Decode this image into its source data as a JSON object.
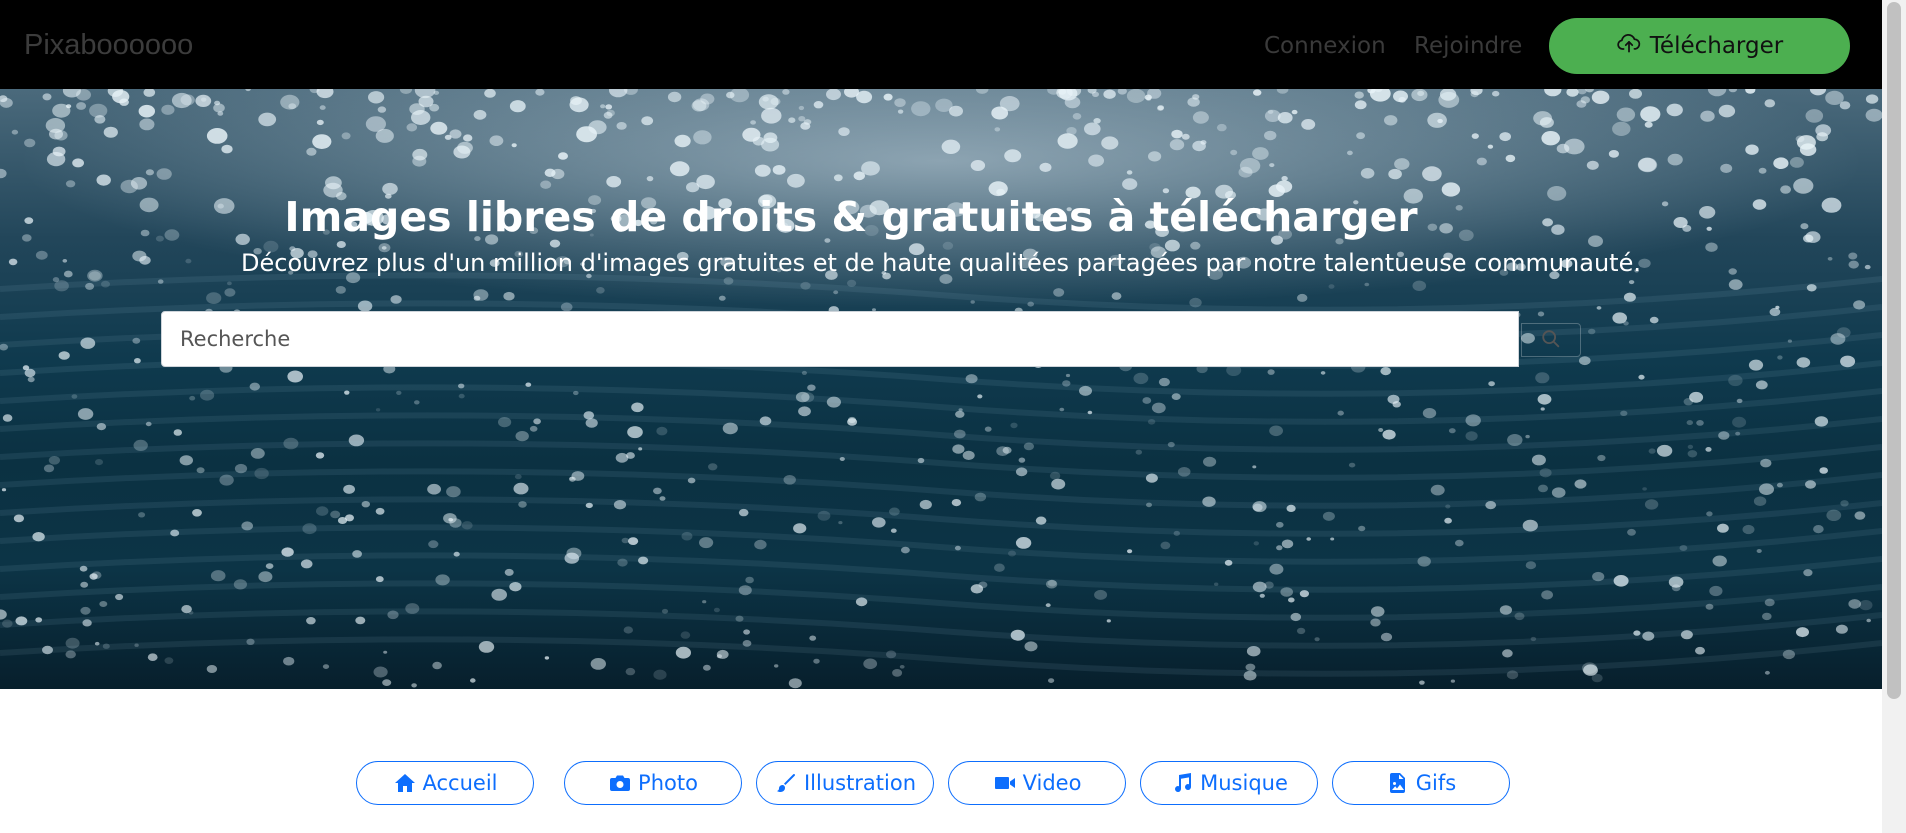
{
  "navbar": {
    "brand": "Pixaboooooo",
    "links": [
      {
        "label": "Connexion"
      },
      {
        "label": "Rejoindre"
      }
    ],
    "upload_label": "Télécharger",
    "upload_color": "#4caf50"
  },
  "hero": {
    "title": "Images libres de droits & gratuites à télécharger",
    "subtitle": "Découvrez plus d'un million d'images gratuites et de haute qualitées partagées par notre talentueuse communauté.",
    "search": {
      "placeholder": "Recherche",
      "value": "",
      "button_icon": "search-icon"
    }
  },
  "categories": [
    {
      "label": "Accueil",
      "icon": "home-icon"
    },
    {
      "label": "Photo",
      "icon": "camera-icon"
    },
    {
      "label": "Illustration",
      "icon": "brush-icon"
    },
    {
      "label": "Video",
      "icon": "video-camera-icon"
    },
    {
      "label": "Musique",
      "icon": "music-note-icon"
    },
    {
      "label": "Gifs",
      "icon": "image-file-icon"
    }
  ],
  "accent_color": "#0d6efd"
}
